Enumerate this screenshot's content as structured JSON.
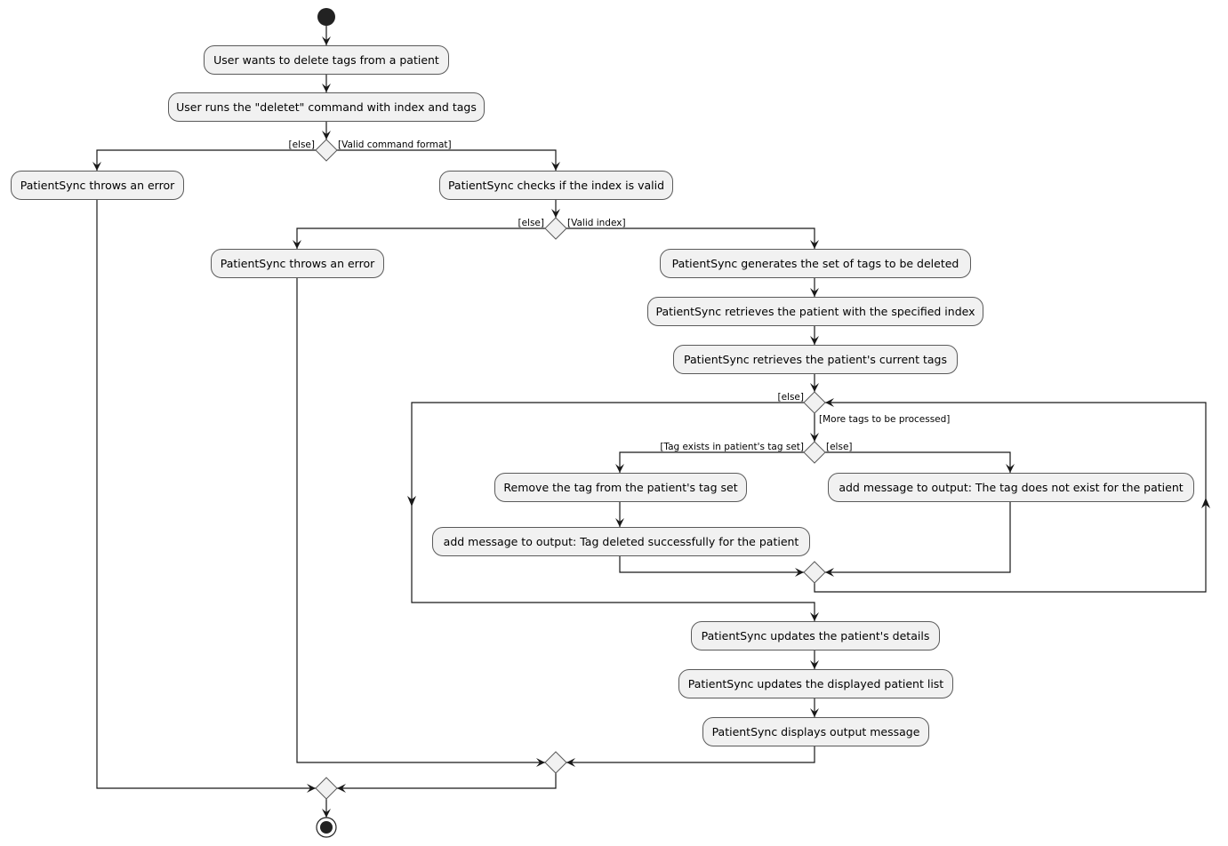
{
  "diagram": {
    "type": "activity",
    "colors": {
      "node_fill": "#f1f1f1",
      "node_border": "#5a5a5a",
      "edge": "#181818",
      "start_end": "#222222"
    },
    "nodes": {
      "n1": "User wants to delete tags from a patient",
      "n2": "User runs the \"deletet\" command with index and tags",
      "n3": "PatientSync throws an error",
      "n4": "PatientSync checks if the index is valid",
      "n5": "PatientSync throws an error",
      "n6": "PatientSync generates the set of tags to be deleted",
      "n7": "PatientSync retrieves the patient with the specified index",
      "n8": "PatientSync retrieves the patient's current tags",
      "n9": "Remove the tag from the patient's tag set",
      "n10": "add message to output: Tag deleted successfully for the patient",
      "n11": "add message to output: The tag does not exist for the patient",
      "n12": "PatientSync updates the patient's details",
      "n13": "PatientSync updates the displayed patient list",
      "n14": "PatientSync displays output message"
    },
    "guards": {
      "d1_else": "[else]",
      "d1_yes": "[Valid command format]",
      "d2_else": "[else]",
      "d2_yes": "[Valid index]",
      "loop_else": "[else]",
      "loop_yes": "[More tags to be processed]",
      "d3_yes": "[Tag exists in patient's tag set]",
      "d3_else": "[else]"
    }
  }
}
